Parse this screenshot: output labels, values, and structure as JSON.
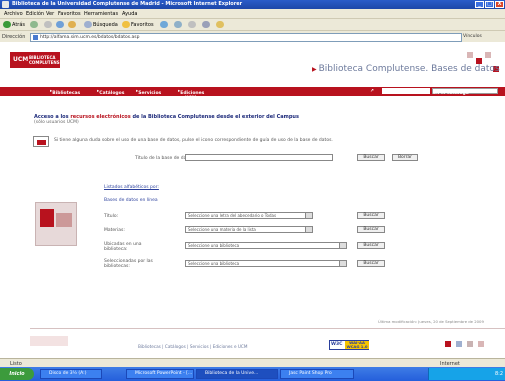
{
  "window": {
    "title": "Biblioteca de la Universidad Complutense de Madrid - Microsoft Internet Explorer",
    "buttons": [
      "_",
      "□",
      "X"
    ]
  },
  "menu": [
    "Archivo",
    "Edición",
    "Ver",
    "Favoritos",
    "Herramientas",
    "Ayuda"
  ],
  "toolbar": {
    "back_label": "Atrás",
    "search_label": "Búsqueda",
    "favorites_label": "Favoritos"
  },
  "address": {
    "label": "Dirección",
    "value": "http://alfama.sim.ucm.es/bdatos/bdatos.asp",
    "go_label": "Vínculos"
  },
  "site": {
    "logo_mark": "UCM",
    "logo_line1": "BIBLIOTECA",
    "logo_line2": "COMPLUTENSE",
    "title": "Biblioteca Complutense. Bases de datos",
    "nav": [
      "Bibliotecas",
      "Catálogos",
      "Servicios",
      "Ediciones e UCM"
    ],
    "search_scope": "En el catálogo"
  },
  "content": {
    "heading_pre": "Acceso a los ",
    "heading_link": "recursos electrónicos",
    "heading_post": " de la Biblioteca Complutense desde el exterior del Campus",
    "subheading": "(sólo usuarios UCM)",
    "help_text": "Si tiene alguna duda sobre el uso de una base de datos, pulse el icono correspondiente de guía de uso de la base de datos.",
    "title_label": "Título de la base de datos",
    "buscar_label": "Buscar",
    "borrar_label": "Borrar",
    "list_link": "Listados alfabéticos por:",
    "online_label": "Bases de datos en línea",
    "rows": [
      {
        "label": "Título:",
        "select": "Seleccione una letra del abecedario o Todas",
        "button": "Buscar"
      },
      {
        "label": "Materias:",
        "select": "Seleccione una materia de la lista",
        "button": "Buscar"
      },
      {
        "label": "Ubicadas en una biblioteca:",
        "select": "Seleccione una biblioteca",
        "button": "Buscar"
      },
      {
        "label": "Seleccionadas por las bibliotecas:",
        "select": "Seleccione una biblioteca",
        "button": "Buscar"
      }
    ],
    "last_modified": "Última modificación: Jueves, 20 de Septiembre de 2009"
  },
  "footer": {
    "links": "Bibliotecas | Catálogos | Servicios | Ediciones e UCM",
    "w3c_left": "W3C",
    "w3c_right": "WAI-AA WCAG 1.0"
  },
  "statusbar": {
    "left": "Listo",
    "zone": "Internet"
  },
  "taskbar": {
    "start": "Inicio",
    "tasks": [
      {
        "label": "Disco de 3½ (A:)",
        "active": false
      },
      {
        "label": "Microsoft PowerPoint - [...",
        "active": false
      },
      {
        "label": "Biblioteca de la Unive...",
        "active": true
      },
      {
        "label": "Jasc Paint Shop Pro",
        "active": false
      }
    ],
    "clock": "8:2"
  }
}
